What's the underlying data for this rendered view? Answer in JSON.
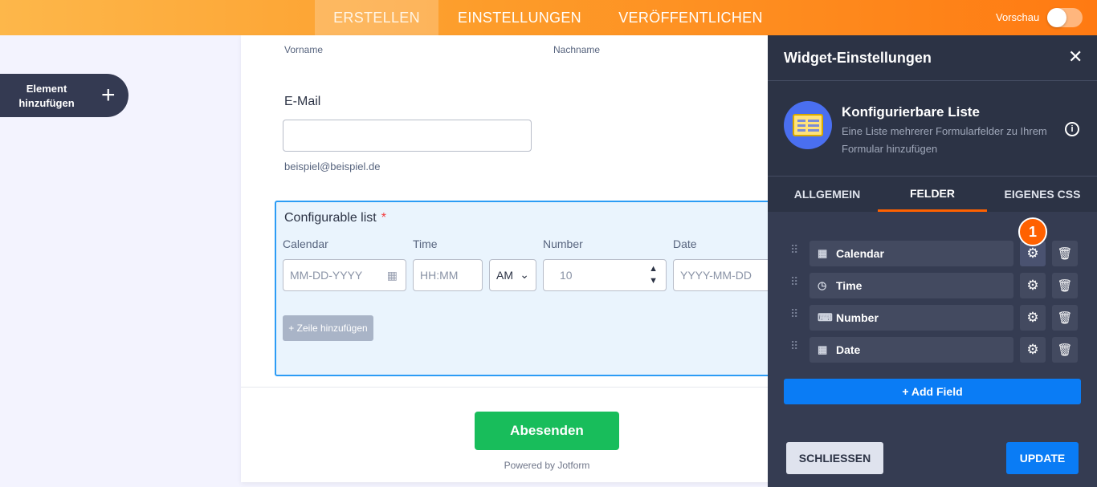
{
  "topbar": {
    "nav": [
      "ERSTELLEN",
      "EINSTELLUNGEN",
      "VERÖFFENTLICHEN"
    ],
    "active": "ERSTELLEN",
    "preview_label": "Vorschau",
    "preview_on": false
  },
  "sidebar": {
    "add_element_label": "Element hinzufügen",
    "add_icon": "+"
  },
  "form": {
    "first_name_sublabel": "Vorname",
    "last_name_sublabel": "Nachname",
    "email_label": "E-Mail",
    "email_sublabel": "beispiel@beispiel.de",
    "configurable_list": {
      "title": "Configurable list",
      "required_mark": "*",
      "columns": [
        "Calendar",
        "Time",
        "Number",
        "Date"
      ],
      "calendar_placeholder": "MM-DD-YYYY",
      "time_placeholder": "HH:MM",
      "ampm_value": "AM",
      "number_placeholder": "10",
      "date_placeholder": "YYYY-MM-DD",
      "add_row_label": "+ Zeile hinzufügen"
    },
    "submit_label": "Abesenden",
    "powered_by": "Powered by Jotform"
  },
  "panel": {
    "title": "Widget-Einstellungen",
    "close_glyph": "✕",
    "widget_title": "Konfigurierbare Liste",
    "widget_desc": "Eine Liste mehrerer Formularfelder zu Ihrem Formular hinzufügen",
    "info_glyph": "i",
    "tabs": [
      "ALLGEMEIN",
      "FELDER",
      "EIGENES CSS"
    ],
    "active_tab": "FELDER",
    "fields": [
      {
        "label": "Calendar",
        "icon": "calendar-icon",
        "glyph": "▦"
      },
      {
        "label": "Time",
        "icon": "clock-icon",
        "glyph": "◷"
      },
      {
        "label": "Number",
        "icon": "number-icon",
        "glyph": "⌨"
      },
      {
        "label": "Date",
        "icon": "calendar-icon",
        "glyph": "▦"
      }
    ],
    "step_badge": "1",
    "add_field_label": "+ Add Field",
    "close_button_label": "SCHLIESSEN",
    "update_button_label": "UPDATE"
  },
  "colors": {
    "accent_orange": "#ff6100",
    "primary_blue": "#0a7cf5",
    "submit_green": "#18bd5b",
    "panel_bg": "#2c3345"
  }
}
